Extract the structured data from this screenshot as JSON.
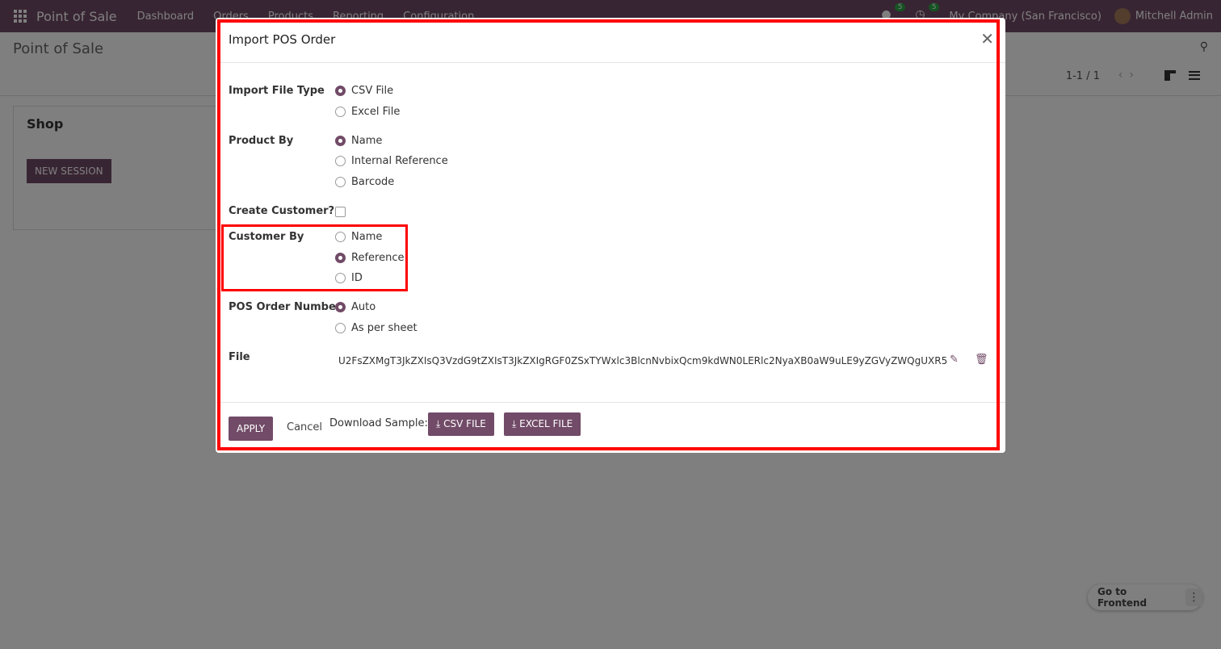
{
  "navbar": {
    "brand": "Point of Sale",
    "menu": [
      "Dashboard",
      "Orders",
      "Products",
      "Reporting",
      "Configuration"
    ],
    "messages_count": "5",
    "activities_count": "5",
    "company": "My Company (San Francisco)",
    "user": "Mitchell Admin"
  },
  "control": {
    "title": "Point of Sale",
    "pager": "1-1 / 1"
  },
  "kanban": {
    "shop_title": "Shop",
    "new_session": "NEW SESSION"
  },
  "floating": {
    "label": "Go to Frontend"
  },
  "modal": {
    "title": "Import POS Order",
    "fields": {
      "import_file_type": {
        "label": "Import File Type",
        "options": [
          "CSV File",
          "Excel File"
        ],
        "selected": "CSV File"
      },
      "product_by": {
        "label": "Product By",
        "options": [
          "Name",
          "Internal Reference",
          "Barcode"
        ],
        "selected": "Name"
      },
      "create_customer": {
        "label": "Create Customer?",
        "checked": false
      },
      "customer_by": {
        "label": "Customer By",
        "options": [
          "Name",
          "Reference",
          "ID"
        ],
        "selected": "Reference"
      },
      "pos_order_number": {
        "label": "POS Order Number",
        "options": [
          "Auto",
          "As per sheet"
        ],
        "selected": "Auto"
      },
      "file": {
        "label": "File",
        "value": "U2FsZXMgT3JkZXIsQ3VzdG9tZXIsT3JkZXIgRGF0ZSxTYWxlc3BlcnNvbixQcm9kdWN0LERlc2NyaXB0aW9uLE9yZGVyZWQgUXR5"
      }
    },
    "footer": {
      "apply": "APPLY",
      "cancel": "Cancel",
      "download_label": "Download Sample:",
      "csv_button": "CSV FILE",
      "excel_button": "EXCEL FILE"
    }
  },
  "colors": {
    "brand": "#714b67",
    "annotation": "#ff0000"
  }
}
